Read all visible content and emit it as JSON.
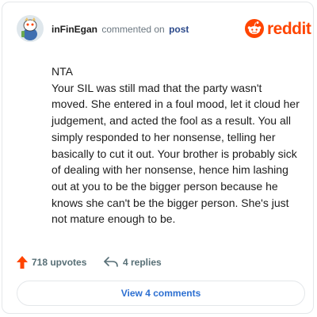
{
  "comment": {
    "author": "inFinEgan",
    "action_text": "commented on",
    "target_link": "post",
    "avatar_icon": "snoo-avatar-icon",
    "body": [
      "NTA",
      "Your SIL was still mad that the party wasn't moved. She entered in a foul mood, let it cloud her judgement, and acted the fool as a result. You all simply responded to her nonsense, telling her basically to cut it out. Your brother is probably sick of dealing with her nonsense, hence him lashing out at you to be the bigger person because he knows she can't be the bigger person. She's just not mature enough to be."
    ]
  },
  "brand": {
    "name": "reddit",
    "icon": "reddit-logo-icon",
    "color": "#ff4500"
  },
  "actions": {
    "upvotes": "718 upvotes",
    "upvote_icon": "upvote-arrow-icon",
    "upvote_color": "#ff4500",
    "replies": "4 replies",
    "reply_icon": "reply-arrow-icon"
  },
  "footer": {
    "view_comments": "View 4 comments",
    "link_color": "#2c6fd1"
  }
}
